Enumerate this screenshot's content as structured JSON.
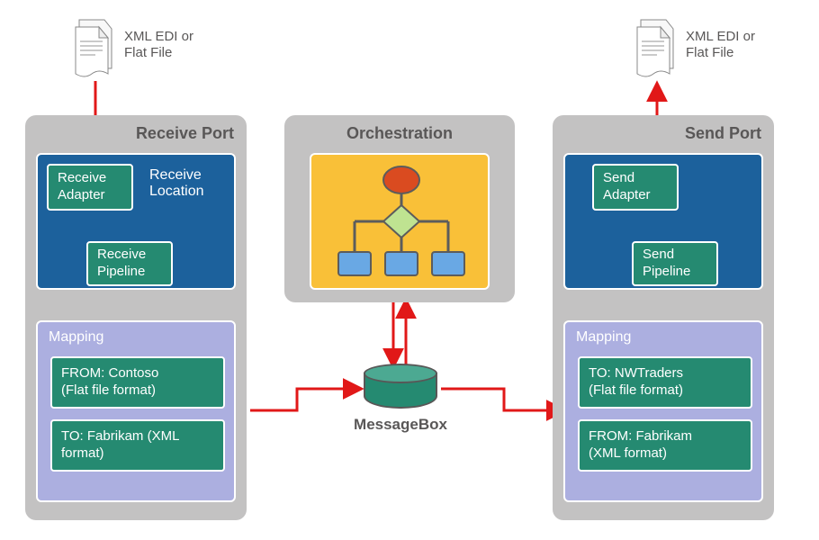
{
  "input_doc_label": "XML EDI or\nFlat File",
  "output_doc_label": "XML EDI or\nFlat File",
  "receive_port": {
    "title": "Receive Port",
    "location_label": "Receive\nLocation",
    "adapter_label": "Receive\nAdapter",
    "pipeline_label": "Receive\nPipeline",
    "mapping_title": "Mapping",
    "mapping_from": "FROM: Contoso\n(Flat file format)",
    "mapping_to": "TO: Fabrikam (XML\nformat)"
  },
  "orchestration": {
    "title": "Orchestration"
  },
  "messagebox_label": "MessageBox",
  "send_port": {
    "title": "Send Port",
    "adapter_label": "Send\nAdapter",
    "pipeline_label": "Send\nPipeline",
    "mapping_title": "Mapping",
    "mapping_to": "TO: NWTraders\n(Flat file format)",
    "mapping_from": "FROM: Fabrikam\n(XML format)"
  },
  "colors": {
    "panel_bg": "#c3c2c2",
    "blue": "#1c619c",
    "green": "#258a71",
    "lavender": "#acafe0",
    "yellow": "#f9c038",
    "arrow": "#e11818",
    "text_gray": "#595757"
  }
}
